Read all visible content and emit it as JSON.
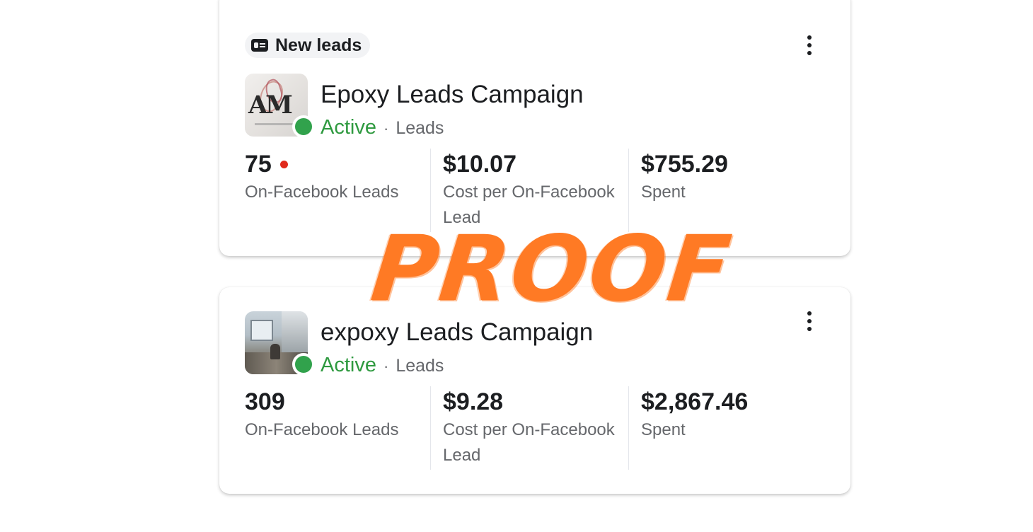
{
  "campaigns": [
    {
      "badge": "New leads",
      "name": "Epoxy Leads Campaign",
      "status": "Active",
      "separator": "·",
      "objective": "Leads",
      "thumbnail_text": "AM",
      "metrics": {
        "leads_value": "75",
        "leads_label": "On-Facebook Leads",
        "cost_value": "$10.07",
        "cost_label": "Cost per On-Facebook Lead",
        "spent_value": "$755.29",
        "spent_label": "Spent"
      }
    },
    {
      "name": "expoxy Leads Campaign",
      "status": "Active",
      "separator": "·",
      "objective": "Leads",
      "metrics": {
        "leads_value": "309",
        "leads_label": "On-Facebook Leads",
        "cost_value": "$9.28",
        "cost_label": "Cost per On-Facebook Lead",
        "spent_value": "$2,867.46",
        "spent_label": "Spent"
      }
    }
  ],
  "overlay": {
    "text": "PROOF",
    "color": "#ff7a24"
  },
  "colors": {
    "active_green": "#2f9a40",
    "status_dot": "#31a24c",
    "alert_dot": "#e02a1c"
  },
  "icons": {
    "badge": "lead-form-icon",
    "menu": "more-vertical-icon"
  }
}
